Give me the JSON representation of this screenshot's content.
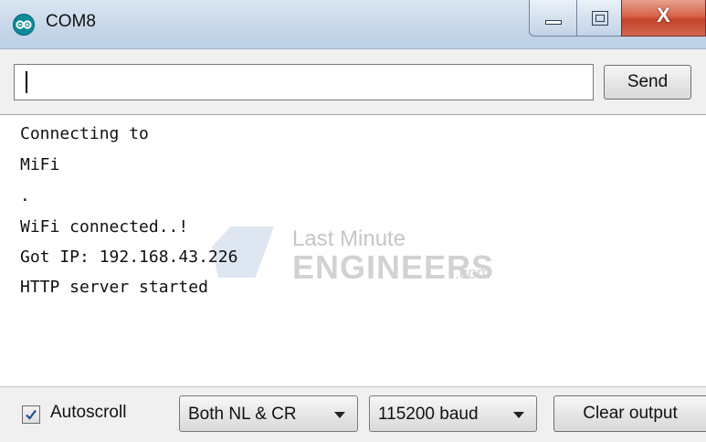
{
  "window": {
    "title": "COM8",
    "icon": "arduino-infinity-icon",
    "controls": {
      "minimize_icon": "minimize-icon",
      "maximize_icon": "maximize-icon",
      "close_label": "X"
    }
  },
  "input": {
    "value": "",
    "send_label": "Send"
  },
  "output": {
    "lines": [
      "Connecting to",
      "MiFi",
      ".",
      "WiFi connected..!",
      "Got IP: 192.168.43.226",
      "HTTP server started"
    ]
  },
  "watermark": {
    "line1": "Last Minute",
    "line2": "ENGINEERS",
    "suffix": ".com"
  },
  "footer": {
    "autoscroll_label": "Autoscroll",
    "autoscroll_checked": true,
    "line_ending": "Both NL & CR",
    "baud_rate": "115200 baud",
    "clear_label": "Clear output"
  },
  "colors": {
    "title_bar": "#c9d8ea",
    "close_button": "#d6654b",
    "app_icon": "#0f8a96"
  }
}
